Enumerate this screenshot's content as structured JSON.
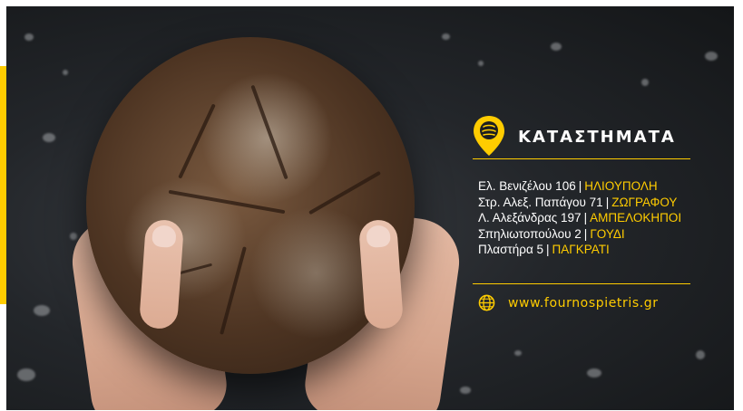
{
  "banner": {
    "heading": "ΚΑΤΑΣΤΗΜΑΤΑ",
    "stores": [
      {
        "address": "Ελ. Βενιζέλου 106",
        "area": "ΗΛΙΟΥΠΟΛΗ"
      },
      {
        "address": "Στρ. Αλεξ. Παπάγου 71",
        "area": "ΖΩΓΡΑΦΟΥ"
      },
      {
        "address": "Λ. Αλεξάνδρας 197",
        "area": "ΑΜΠΕΛΟΚΗΠΟΙ"
      },
      {
        "address": "Σπηλιωτοπούλου 2",
        "area": "ΓΟΥΔΙ"
      },
      {
        "address": "Πλαστήρα 5",
        "area": "ΠΑΓΚΡΑΤΙ"
      }
    ],
    "separator": "|",
    "website": "www.fournospietris.gr"
  },
  "icons": {
    "pin": "location-pin-icon",
    "globe": "globe-icon"
  },
  "colors": {
    "accent": "#ffcc00",
    "text": "#ffffff",
    "background": "#23262a"
  }
}
